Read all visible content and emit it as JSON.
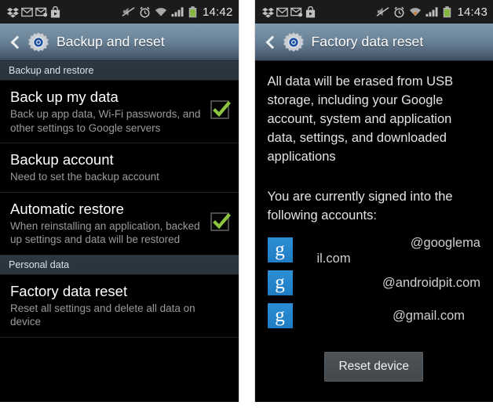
{
  "left_phone": {
    "status_bar": {
      "time": "14:42",
      "icons_left": [
        "dropbox-icon",
        "gmail-icon",
        "email-sync-icon",
        "play-store-icon"
      ],
      "icons_right": [
        "mute-icon",
        "alarm-clock-icon",
        "wifi-icon",
        "signal-bars-icon",
        "battery-icon"
      ]
    },
    "action_bar": {
      "back_label": "back",
      "app_icon": "settings-gear-icon",
      "title": "Backup and reset"
    },
    "sections": [
      {
        "header": "Backup and restore",
        "rows": [
          {
            "title": "Back up my data",
            "subtitle": "Back up app data, Wi-Fi passwords, and other settings to Google servers",
            "checked": true
          },
          {
            "title": "Backup account",
            "subtitle": "Need to set the backup account",
            "checked": false
          },
          {
            "title": "Automatic restore",
            "subtitle": "When reinstalling an application, backed up settings and data will be restored",
            "checked": true
          }
        ]
      },
      {
        "header": "Personal data",
        "rows": [
          {
            "title": "Factory data reset",
            "subtitle": "Reset all settings and delete all data on device",
            "checked": false
          }
        ]
      }
    ]
  },
  "right_phone": {
    "status_bar": {
      "time": "14:43",
      "icons_left": [
        "dropbox-icon",
        "gmail-icon",
        "email-sync-icon",
        "play-store-icon"
      ],
      "icons_right": [
        "mute-icon",
        "alarm-clock-icon",
        "wifi-icon",
        "signal-bars-icon",
        "battery-icon"
      ]
    },
    "action_bar": {
      "back_label": "back",
      "app_icon": "settings-gear-icon",
      "title": "Factory data reset"
    },
    "warning_text": "All data will be erased from USB storage, including your Google account, system and application data, settings, and downloaded applications",
    "accounts_intro": "You are currently signed into the following accounts:",
    "accounts": [
      {
        "icon_letter": "g",
        "email": "@googlema",
        "email_wrap": "il.com"
      },
      {
        "icon_letter": "g",
        "email": "@androidpit.com",
        "email_wrap": ""
      },
      {
        "icon_letter": "g",
        "email": "@gmail.com",
        "email_wrap": ""
      }
    ],
    "reset_button": "Reset device"
  },
  "colors": {
    "accent_blue": "#1f7cc2",
    "check_green": "#8cc540",
    "action_bar_top": "#7e97aa",
    "action_bar_bottom": "#3c4c5c",
    "section_header_bg": "#2d3942",
    "battery_green": "#8cc540"
  }
}
